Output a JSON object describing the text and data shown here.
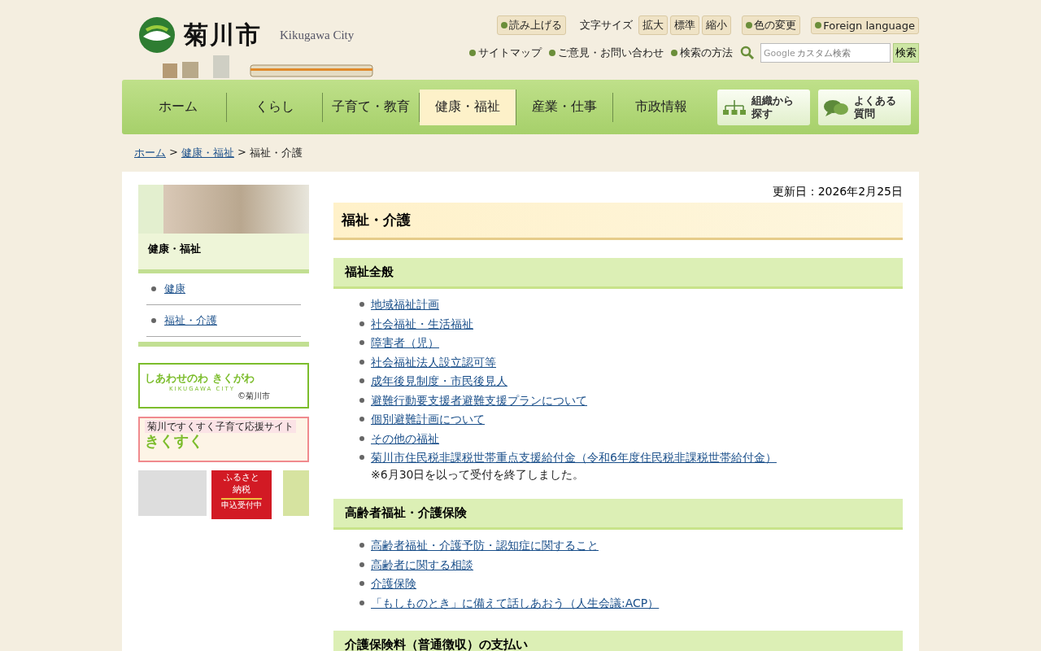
{
  "header": {
    "logo_text": "菊川市",
    "logo_sub": "Kikugawa City",
    "tools": [
      {
        "kind": "button",
        "label": "読み上げる"
      },
      {
        "kind": "label",
        "label": "文字サイズ"
      },
      {
        "kind": "size",
        "label": "拡大"
      },
      {
        "kind": "size",
        "label": "標準"
      },
      {
        "kind": "size",
        "label": "縮小"
      },
      {
        "kind": "button",
        "label": "色の変更"
      },
      {
        "kind": "button",
        "label": "Foreign language"
      }
    ],
    "links": [
      "サイトマップ",
      "ご意見・お問い合わせ",
      "検索の方法"
    ],
    "search": {
      "placeholder": "カスタム検索",
      "brand": "Google",
      "button": "検索"
    }
  },
  "nav": [
    {
      "kind": "text",
      "label": "ホーム",
      "selected": false
    },
    {
      "kind": "text",
      "label": "くらし",
      "selected": false
    },
    {
      "kind": "text",
      "label": "子育て・教育",
      "selected": false
    },
    {
      "kind": "text",
      "label": "健康・福祉",
      "selected": true
    },
    {
      "kind": "text",
      "label": "産業・仕事",
      "selected": false
    },
    {
      "kind": "text",
      "label": "市政情報",
      "selected": false
    },
    {
      "kind": "org",
      "lines": [
        "組織から",
        "探す"
      ],
      "selected": false
    },
    {
      "kind": "faq",
      "lines": [
        "よくある",
        "質問"
      ],
      "selected": false
    }
  ],
  "breadcrumb": {
    "links": [
      "ホーム",
      "健康・福祉"
    ],
    "separator": ">",
    "current": "福祉・介護"
  },
  "sidebar": {
    "title": "健康・福祉",
    "items": [
      "健康",
      "福祉・介護"
    ],
    "banners": [
      {
        "kind": "shiawase",
        "texts": [
          "しあわせのわ きくがわ",
          "KIKUGAWA CITY",
          "©菊川市"
        ]
      },
      {
        "kind": "kikusuku",
        "texts": [
          "菊川ですくすく子育て応援サイト",
          "きくすく"
        ]
      },
      {
        "kind": "furusato",
        "texts": [
          "ふるさと",
          "納税",
          "申込受付中"
        ]
      }
    ]
  },
  "updated": "更新日：2026年2月25日",
  "page_title": "福祉・介護",
  "sections": [
    {
      "heading": "福祉全般",
      "items": [
        {
          "link": "地域福祉計画"
        },
        {
          "link": "社会福祉・生活福祉"
        },
        {
          "link": "障害者（児）"
        },
        {
          "link": "社会福祉法人設立認可等"
        },
        {
          "link": "成年後見制度・市民後見人"
        },
        {
          "link": "避難行動要支援者避難支援プランについて"
        },
        {
          "link": "個別避難計画について"
        },
        {
          "link": "その他の福祉"
        },
        {
          "link": "菊川市住民税非課税世帯重点支援給付金（令和6年度住民税非課税世帯給付金）",
          "note": "※6月30日を以って受付を終了しました。"
        }
      ]
    },
    {
      "heading": "高齢者福祉・介護保険",
      "items": [
        {
          "link": "高齢者福祉・介護予防・認知症に関すること"
        },
        {
          "link": "高齢者に関する相談"
        },
        {
          "link": "介護保険"
        },
        {
          "link": "「もしものとき」に備えて話しあおう（人生会議:ACP）"
        }
      ]
    },
    {
      "heading": "介護保険料（普通徴収）の支払い"
    }
  ]
}
